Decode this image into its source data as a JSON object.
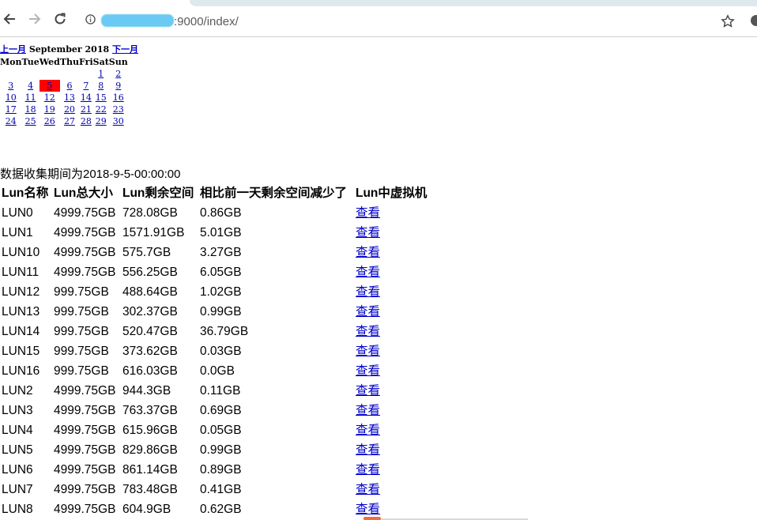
{
  "browser": {
    "url_text": ":9000/index/"
  },
  "calendar": {
    "prev_label": "上一月",
    "month_title": "September 2018",
    "next_label": "下一月",
    "weekdays": [
      "Mon",
      "Tue",
      "Wed",
      "Thu",
      "Fri",
      "Sat",
      "Sun"
    ],
    "weeks": [
      [
        "",
        "",
        "",
        "",
        "",
        "1",
        "2"
      ],
      [
        "3",
        "4",
        "5",
        "6",
        "7",
        "8",
        "9"
      ],
      [
        "10",
        "11",
        "12",
        "13",
        "14",
        "15",
        "16"
      ],
      [
        "17",
        "18",
        "19",
        "20",
        "21",
        "22",
        "23"
      ],
      [
        "24",
        "25",
        "26",
        "27",
        "28",
        "29",
        "30"
      ]
    ],
    "selected_day": "5",
    "selected_color": "#ff0000"
  },
  "period_text": "数据收集期间为2018-9-5-00:00:00",
  "table": {
    "headers": [
      "Lun名称",
      "Lun总大小",
      "Lun剩余空间",
      "相比前一天剩余空间减少了",
      "Lun中虚拟机"
    ],
    "rows": [
      {
        "name": "LUN0",
        "total": "4999.75GB",
        "free": "728.08GB",
        "delta": "0.86GB",
        "link": "查看"
      },
      {
        "name": "LUN1",
        "total": "4999.75GB",
        "free": "1571.91GB",
        "delta": "5.01GB",
        "link": "查看"
      },
      {
        "name": "LUN10",
        "total": "4999.75GB",
        "free": "575.7GB",
        "delta": "3.27GB",
        "link": "查看"
      },
      {
        "name": "LUN11",
        "total": "4999.75GB",
        "free": "556.25GB",
        "delta": "6.05GB",
        "link": "查看"
      },
      {
        "name": "LUN12",
        "total": "999.75GB",
        "free": "488.64GB",
        "delta": "1.02GB",
        "link": "查看"
      },
      {
        "name": "LUN13",
        "total": "999.75GB",
        "free": "302.37GB",
        "delta": "0.99GB",
        "link": "查看"
      },
      {
        "name": "LUN14",
        "total": "999.75GB",
        "free": "520.47GB",
        "delta": "36.79GB",
        "link": "查看"
      },
      {
        "name": "LUN15",
        "total": "999.75GB",
        "free": "373.62GB",
        "delta": "0.03GB",
        "link": "查看"
      },
      {
        "name": "LUN16",
        "total": "999.75GB",
        "free": "616.03GB",
        "delta": "0.0GB",
        "link": "查看"
      },
      {
        "name": "LUN2",
        "total": "4999.75GB",
        "free": "944.3GB",
        "delta": "0.11GB",
        "link": "查看"
      },
      {
        "name": "LUN3",
        "total": "4999.75GB",
        "free": "763.37GB",
        "delta": "0.69GB",
        "link": "查看"
      },
      {
        "name": "LUN4",
        "total": "4999.75GB",
        "free": "615.96GB",
        "delta": "0.05GB",
        "link": "查看"
      },
      {
        "name": "LUN5",
        "total": "4999.75GB",
        "free": "829.86GB",
        "delta": "0.99GB",
        "link": "查看"
      },
      {
        "name": "LUN6",
        "total": "4999.75GB",
        "free": "861.14GB",
        "delta": "0.89GB",
        "link": "查看"
      },
      {
        "name": "LUN7",
        "total": "4999.75GB",
        "free": "783.48GB",
        "delta": "0.41GB",
        "link": "查看"
      },
      {
        "name": "LUN8",
        "total": "4999.75GB",
        "free": "604.9GB",
        "delta": "0.62GB",
        "link": "查看"
      }
    ]
  },
  "colors": {
    "link": "#0000cc",
    "url_redaction": "#63c8f3"
  },
  "icons": [
    "back-arrow-icon",
    "forward-arrow-icon",
    "reload-icon",
    "info-icon",
    "star-icon",
    "profile-icon"
  ]
}
